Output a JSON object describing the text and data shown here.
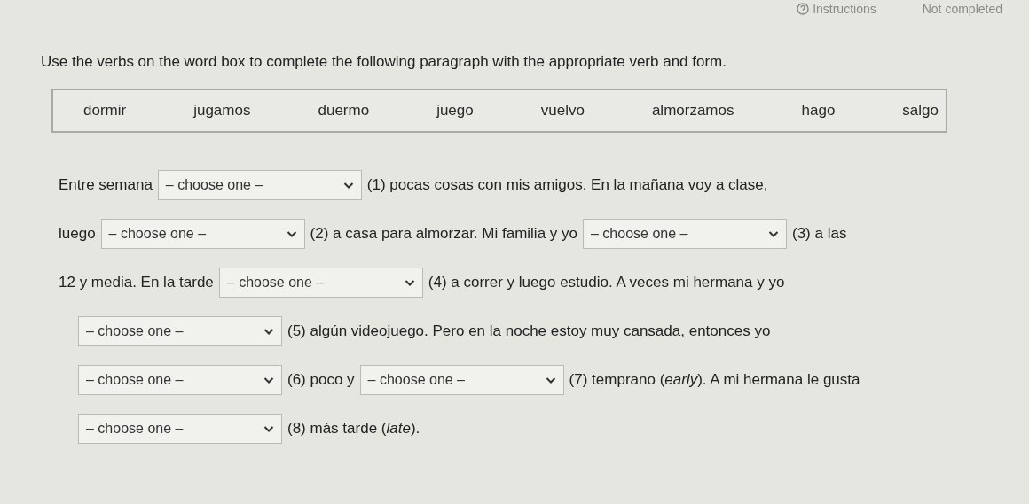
{
  "header": {
    "instructions": "Instructions",
    "status": "Not completed"
  },
  "prompt": "Use the verbs on the word box to complete the following paragraph with the appropriate verb and form.",
  "word_box": [
    "dormir",
    "jugamos",
    "duermo",
    "juego",
    "vuelvo",
    "almorzamos",
    "hago",
    "salgo"
  ],
  "paragraph_lines": [
    [
      {
        "kind": "text",
        "text": "Entre semana"
      },
      {
        "kind": "select",
        "value": "– choose one –"
      },
      {
        "kind": "text",
        "text": "(1) pocas cosas con mis amigos. En la mañana voy a clase,"
      }
    ],
    [
      {
        "kind": "text",
        "text": "luego"
      },
      {
        "kind": "select",
        "value": "– choose one –"
      },
      {
        "kind": "text",
        "text": "(2) a casa para almorzar. Mi familia y yo"
      },
      {
        "kind": "select",
        "value": "– choose one –"
      },
      {
        "kind": "text",
        "text": "(3) a las"
      }
    ],
    [
      {
        "kind": "text",
        "text": "12 y media. En la tarde"
      },
      {
        "kind": "select",
        "value": "– choose one –"
      },
      {
        "kind": "text",
        "text": "(4) a correr y luego estudio. A veces mi hermana y yo"
      }
    ],
    [
      {
        "kind": "select",
        "value": "– choose one –"
      },
      {
        "kind": "text",
        "text": "(5) algún videojuego. Pero en la noche estoy muy cansada, entonces yo"
      }
    ],
    [
      {
        "kind": "select",
        "value": "– choose one –"
      },
      {
        "kind": "text",
        "text": "(6) poco y"
      },
      {
        "kind": "select",
        "value": "– choose one –"
      },
      {
        "kind": "text",
        "text": "(7) temprano (*early*). A mi hermana le gusta"
      }
    ],
    [
      {
        "kind": "select",
        "value": "– choose one –"
      },
      {
        "kind": "text",
        "text": "(8) más tarde (*late*)."
      }
    ]
  ]
}
